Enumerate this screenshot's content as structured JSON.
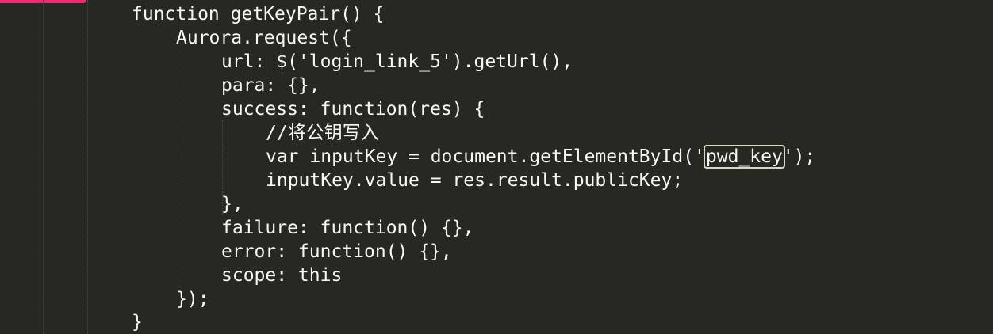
{
  "editor": {
    "colors": {
      "background": "#272822",
      "text": "#f8f8f2",
      "tab_marker": "#f92672",
      "highlight_border": "#d8d8c8"
    },
    "lines": [
      "function getKeyPair() {",
      "Aurora.request({",
      "url: $('login_link_5').getUrl(),",
      "para: {},",
      "success: function(res) {",
      "//将公钥写入",
      "var inputKey = document.getElementById('",
      "pwd_key",
      "');",
      "inputKey.value = res.result.publicKey;",
      "},",
      "failure: function() {},",
      "error: function() {},",
      "scope: this",
      "});",
      "}"
    ]
  }
}
